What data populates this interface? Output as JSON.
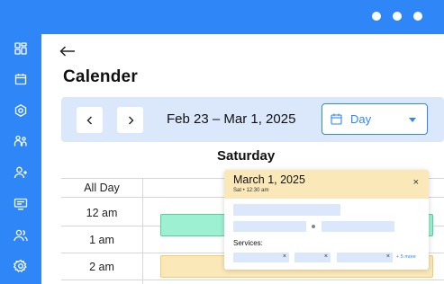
{
  "colors": {
    "primary": "#2f86f6",
    "date_bar_bg": "#dbe7fb",
    "event_green": "#9df0d1",
    "event_green_border": "#5ccc9f",
    "event_yellow": "#fbe8b8",
    "event_yellow_border": "#f0cd72",
    "popup_header": "#fbe8b8"
  },
  "window": {
    "controls": [
      "dot",
      "dot",
      "dot"
    ]
  },
  "sidebar": {
    "items": [
      {
        "icon": "dashboard-icon"
      },
      {
        "icon": "calendar-icon"
      },
      {
        "icon": "settings-hex-icon"
      },
      {
        "icon": "staff-icon"
      },
      {
        "icon": "add-user-icon"
      },
      {
        "icon": "monitor-icon"
      },
      {
        "icon": "users-icon"
      },
      {
        "icon": "gear-icon"
      }
    ]
  },
  "header": {
    "back_icon": "arrow-left-icon",
    "title": "Calender"
  },
  "toolbar": {
    "prev_icon": "chevron-left-icon",
    "next_icon": "chevron-right-icon",
    "date_range": "Feb 23 – Mar 1, 2025",
    "view_select": {
      "icon": "calendar-icon",
      "value": "Day",
      "caret": "caret-down-icon"
    }
  },
  "day_view": {
    "day_name": "Saturday",
    "all_day_label": "All Day",
    "time_labels": [
      "12 am",
      "1 am",
      "2 am"
    ]
  },
  "popup": {
    "title": "March 1, 2025",
    "subtitle": "Sat  •  12:30 am",
    "close": "×",
    "services_label": "Services:",
    "chip_close": "×",
    "more_text": "+ 5 more"
  }
}
